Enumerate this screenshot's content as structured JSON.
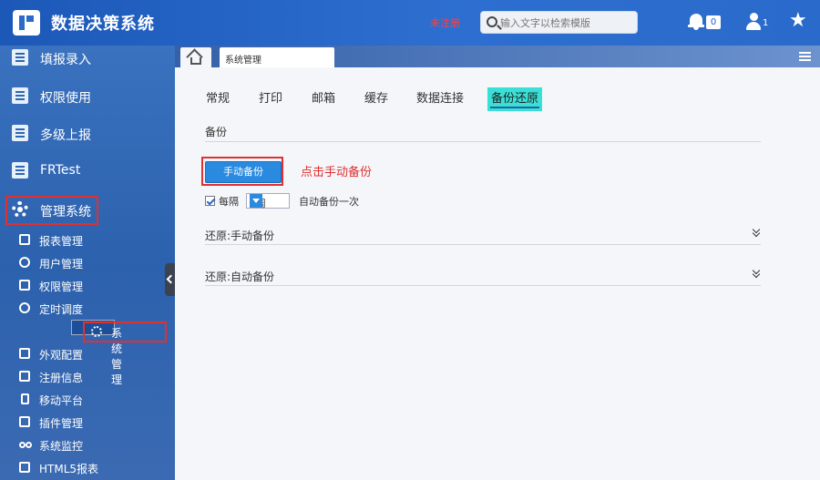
{
  "header": {
    "app_title": "数据决策系统",
    "unregistered": "未注册",
    "search_placeholder": "输入文字以检索模版",
    "notification_count": "0",
    "user_count": "1"
  },
  "sidebar": {
    "main_items": [
      {
        "label": "填报录入"
      },
      {
        "label": "权限使用"
      },
      {
        "label": "多级上报"
      },
      {
        "label": "FRTest"
      },
      {
        "label": "管理系统"
      }
    ],
    "sub_items": [
      {
        "label": "报表管理",
        "icon": "report-icon"
      },
      {
        "label": "用户管理",
        "icon": "user-icon"
      },
      {
        "label": "权限管理",
        "icon": "lock-icon"
      },
      {
        "label": "定时调度",
        "icon": "clock-icon"
      },
      {
        "label": "系统管理",
        "icon": "gear-icon"
      },
      {
        "label": "外观配置",
        "icon": "paint-roller-icon"
      },
      {
        "label": "注册信息",
        "icon": "clipboard-icon"
      },
      {
        "label": "移动平台",
        "icon": "mobile-icon"
      },
      {
        "label": "插件管理",
        "icon": "plugin-icon"
      },
      {
        "label": "系统监控",
        "icon": "binoculars-icon"
      },
      {
        "label": "HTML5报表",
        "icon": "html5-icon"
      }
    ]
  },
  "main": {
    "open_tab": "系统管理",
    "tabs": [
      "常规",
      "打印",
      "邮箱",
      "缓存",
      "数据连接",
      "备份还原"
    ],
    "active_tab": "备份还原",
    "backup_section_title": "备份",
    "manual_backup_button": "手动备份",
    "annotation": "点击手动备份",
    "every_label": "每隔",
    "interval_value": "1周",
    "auto_backup_text": "自动备份一次",
    "restore_manual_title": "还原:手动备份",
    "restore_auto_title": "还原:自动备份"
  },
  "colors": {
    "topbar": "#1f5fbf",
    "sidebar": "#2f66b3",
    "active_tab_highlight": "#39e0d6",
    "annotation_red": "#e03030",
    "button_blue": "#2a8ae0"
  }
}
